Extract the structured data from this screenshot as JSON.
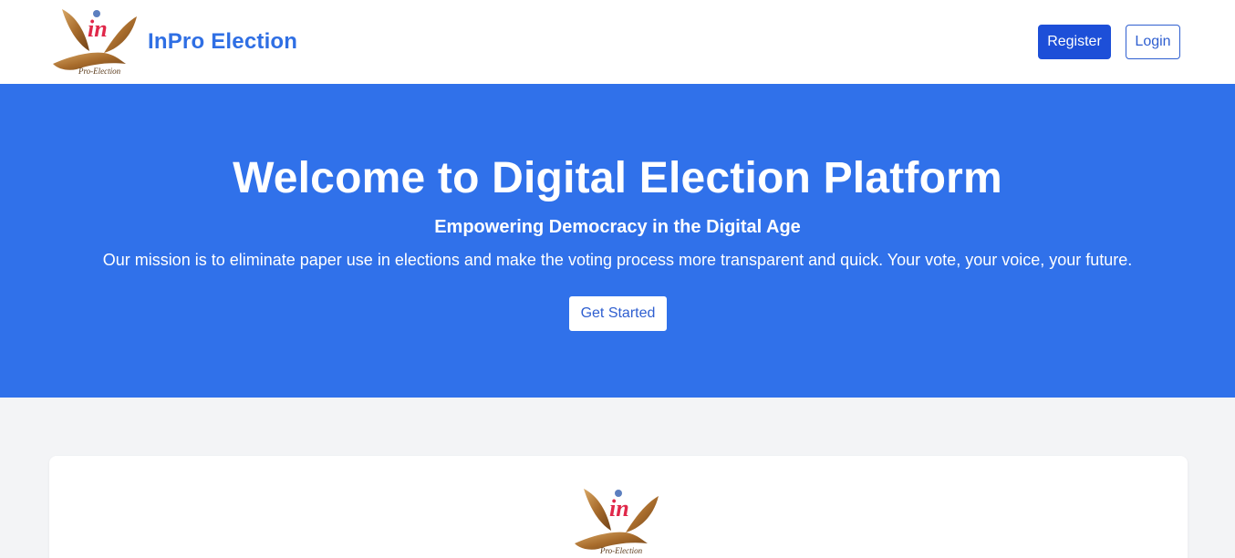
{
  "header": {
    "brand_name": "InPro Election",
    "logo_text": "Pro-Election",
    "logo_letters": "in",
    "register_label": "Register",
    "login_label": "Login"
  },
  "hero": {
    "title": "Welcome to Digital Election Platform",
    "subtitle": "Empowering Democracy in the Digital Age",
    "mission": "Our mission is to eliminate paper use in elections and make the voting process more transparent and quick. Your vote, your voice, your future.",
    "cta_label": "Get Started"
  },
  "colors": {
    "brand_blue": "#2f6fe4",
    "hero_bg": "#3071ea",
    "register_bg": "#1d4fd8",
    "logo_gold": "#b07a3a",
    "logo_red": "#e0284a"
  }
}
